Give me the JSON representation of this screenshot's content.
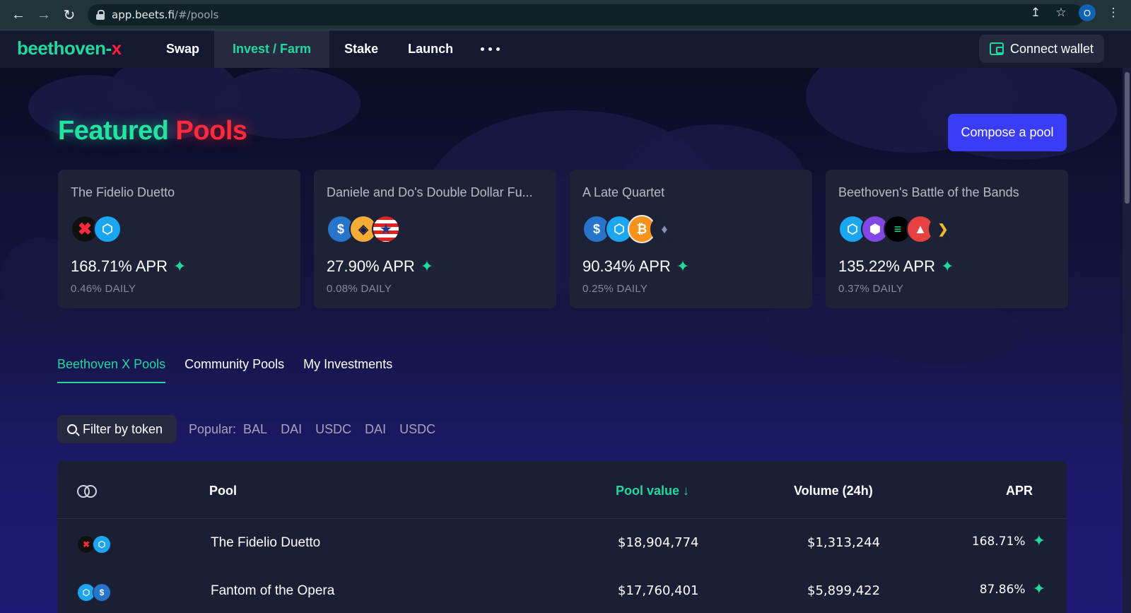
{
  "browser": {
    "url_host": "app.beets.fi",
    "url_path": "/#/pools",
    "profile_initial": "O"
  },
  "header": {
    "logo_main": "beethoven-",
    "logo_x": "x",
    "nav": [
      "Swap",
      "Invest / Farm",
      "Stake",
      "Launch"
    ],
    "active_nav": "Invest / Farm",
    "connect_label": "Connect wallet"
  },
  "featured": {
    "title_word1": "Featured",
    "title_word2": "Pools",
    "compose_label": "Compose a pool",
    "cards": [
      {
        "name": "The Fidelio Duetto",
        "apr": "168.71% APR",
        "daily": "0.46% DAILY"
      },
      {
        "name": "Daniele and Do's Double Dollar Fu...",
        "apr": "27.90% APR",
        "daily": "0.08% DAILY"
      },
      {
        "name": "A Late Quartet",
        "apr": "90.34% APR",
        "daily": "0.25% DAILY"
      },
      {
        "name": "Beethoven's Battle of the Bands",
        "apr": "135.22% APR",
        "daily": "0.37% DAILY"
      }
    ]
  },
  "tabs": [
    "Beethoven X Pools",
    "Community Pools",
    "My Investments"
  ],
  "active_tab": "Beethoven X Pools",
  "filter": {
    "label": "Filter by token",
    "popular_label": "Popular:",
    "popular_tokens": [
      "BAL",
      "DAI",
      "USDC",
      "DAI",
      "USDC"
    ]
  },
  "table": {
    "headers": {
      "pool": "Pool",
      "value": "Pool value ↓",
      "volume": "Volume (24h)",
      "apr": "APR"
    },
    "rows": [
      {
        "pool": "The Fidelio Duetto",
        "value": "$18,904,774",
        "volume": "$1,313,244",
        "apr": "168.71%"
      },
      {
        "pool": "Fantom of the Opera",
        "value": "$17,760,401",
        "volume": "$5,899,422",
        "apr": "87.86%"
      }
    ]
  },
  "colors": {
    "accent_green": "#22d99c",
    "accent_red": "#ff2a3c",
    "button_blue": "#3b3cf5",
    "card_bg": "#1e2236"
  },
  "icons": [
    "back-arrow-icon",
    "forward-arrow-icon",
    "reload-icon",
    "lock-icon",
    "share-icon",
    "star-icon",
    "menu-kebab-icon",
    "wallet-icon",
    "sparkle-icon",
    "search-icon",
    "rings-icon"
  ]
}
